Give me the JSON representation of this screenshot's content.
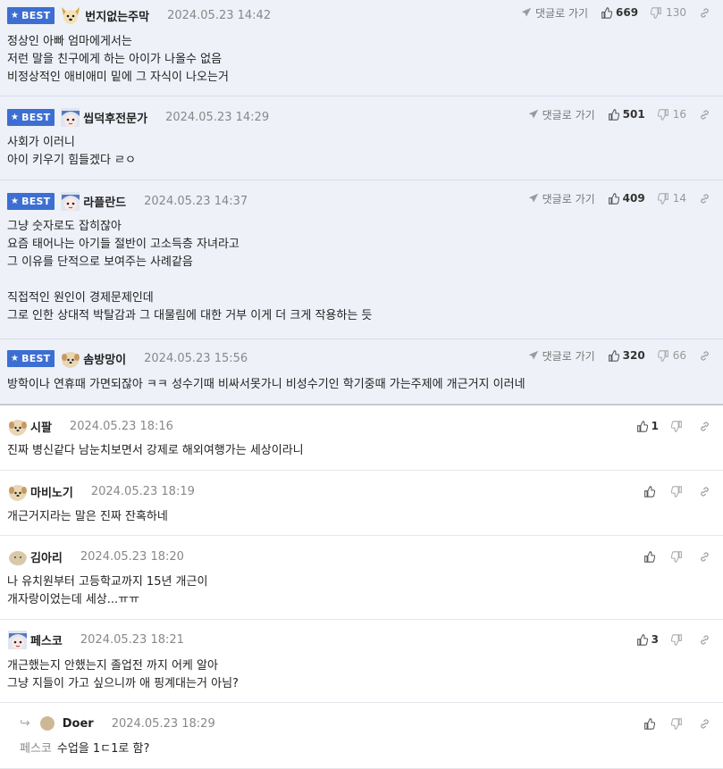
{
  "best_label": "BEST",
  "goto_label": "댓글로 가기",
  "comments": [
    {
      "best": true,
      "nickname": "번지없는주막",
      "date": "2024.05.23 14:42",
      "likes": "669",
      "dislikes": "130",
      "avatar_icon": "dog-avatar-icon",
      "lines": [
        "정상인 아빠 엄마에게서는",
        "저런 말을 친구에게 하는 아이가 나올수 없음",
        "비정상적인 애비애미 밑에 그 자식이 나오는거"
      ]
    },
    {
      "best": true,
      "nickname": "씹덕후전문가",
      "date": "2024.05.23 14:29",
      "likes": "501",
      "dislikes": "16",
      "avatar_icon": "anime-avatar-icon",
      "lines": [
        "사회가 이러니",
        "아이 키우기 힘들겠다 ㄹㅇ"
      ]
    },
    {
      "best": true,
      "nickname": "라플란드",
      "date": "2024.05.23 14:37",
      "likes": "409",
      "dislikes": "14",
      "avatar_icon": "anime-avatar-icon",
      "lines": [
        "그냥 숫자로도 잡히잖아",
        "요즘 태어나는 아기들 절반이 고소득층 자녀라고",
        "그 이유를 단적으로 보여주는 사례같음",
        "",
        "직접적인 원인이 경제문제인데",
        "그로 인한 상대적 박탈감과 그 대물림에 대한 거부 이게 더 크게 작용하는 듯"
      ]
    },
    {
      "best": true,
      "nickname": "솜방망이",
      "date": "2024.05.23 15:56",
      "likes": "320",
      "dislikes": "66",
      "avatar_icon": "puppy-avatar-icon",
      "lines": [
        "방학이나 연휴때 가면되잖아 ㅋㅋ 성수기때 비싸서못가니 비성수기인 학기중때 가는주제에 개근거지 이러네"
      ]
    },
    {
      "best": false,
      "nickname": "시팔",
      "date": "2024.05.23 18:16",
      "likes": "1",
      "dislikes": "",
      "avatar_icon": "puppy-avatar-icon",
      "lines": [
        "진짜 병신같다 남눈치보면서 강제로 해외여행가는 세상이라니"
      ]
    },
    {
      "best": false,
      "nickname": "마비노기",
      "date": "2024.05.23 18:19",
      "likes": "",
      "dislikes": "",
      "avatar_icon": "puppy-avatar-icon",
      "lines": [
        "개근거지라는 말은 진짜 잔혹하네"
      ]
    },
    {
      "best": false,
      "nickname": "김아리",
      "date": "2024.05.23 18:20",
      "likes": "",
      "dislikes": "",
      "avatar_icon": "blob-avatar-icon",
      "lines": [
        "나 유치원부터 고등학교까지 15년 개근이",
        "개자랑이었는데 세상...ㅠㅠ"
      ]
    },
    {
      "best": false,
      "nickname": "페스코",
      "date": "2024.05.23 18:21",
      "likes": "3",
      "dislikes": "",
      "avatar_icon": "anime-avatar-icon",
      "lines": [
        "개근했는지 안했는지 졸업전 까지 어케 알아",
        "그냥 지들이 가고 싶으니까 애 핑계대는거 아님?"
      ]
    },
    {
      "best": false,
      "reply": true,
      "nickname": "Doer",
      "date": "2024.05.23 18:29",
      "likes": "",
      "dislikes": "",
      "avatar_icon": "plain-avatar-icon",
      "mention": "페스코",
      "lines": [
        "수업을 1ㄷ1로 함?"
      ]
    }
  ]
}
